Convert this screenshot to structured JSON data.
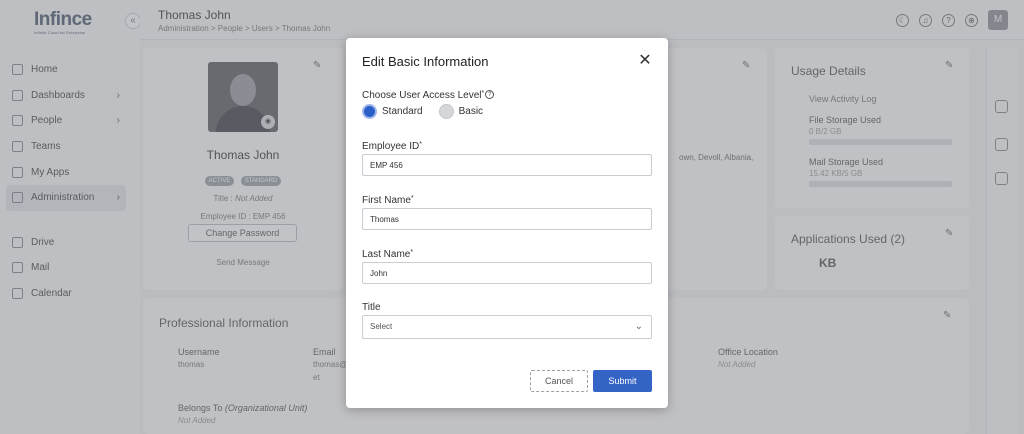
{
  "app": {
    "logo_text": "Infince",
    "logo_tagline": "Infinite Cloud for Enterprise",
    "collapse_glyph": "«"
  },
  "sidebar": {
    "items": [
      {
        "label": "Home",
        "icon": "home-icon",
        "has_children": false,
        "active": false
      },
      {
        "label": "Dashboards",
        "icon": "dashboard-icon",
        "has_children": true,
        "active": false
      },
      {
        "label": "People",
        "icon": "people-icon",
        "has_children": true,
        "active": false
      },
      {
        "label": "Teams",
        "icon": "teams-icon",
        "has_children": false,
        "active": false
      },
      {
        "label": "My Apps",
        "icon": "apps-icon",
        "has_children": false,
        "active": false
      },
      {
        "label": "Administration",
        "icon": "admin-icon",
        "has_children": true,
        "active": true
      }
    ],
    "secondary_items": [
      {
        "label": "Drive",
        "icon": "drive-icon"
      },
      {
        "label": "Mail",
        "icon": "mail-icon"
      },
      {
        "label": "Calendar",
        "icon": "calendar-icon"
      }
    ]
  },
  "header": {
    "title": "Thomas John",
    "breadcrumb": "Administration > People > Users > Thomas John",
    "avatar_initial": "M",
    "icons": [
      "moon-icon",
      "bell-icon",
      "help-icon",
      "globe-icon"
    ]
  },
  "profile": {
    "name": "Thomas John",
    "badges": [
      "ACTIVE",
      "STANDARD"
    ],
    "title_label": "Title :",
    "title_value": "Not Added",
    "employee_id_line": "Employee ID : EMP 456",
    "change_password": "Change Password",
    "send_message": "Send Message"
  },
  "address_snippet": "own, Devoll, Albania,",
  "usage": {
    "title": "Usage Details",
    "activity_log": "View Activity Log",
    "file_label": "File Storage Used",
    "file_value": "0 B/2 GB",
    "mail_label": "Mail Storage Used",
    "mail_value": "15.42 KB/5 GB"
  },
  "apps_used": {
    "title": "Applications Used (2)",
    "app_label": "KB"
  },
  "professional": {
    "title": "Professional Information",
    "username_label": "Username",
    "username_value": "thomas",
    "email_label": "Email",
    "email_value": "thomas@",
    "email_value_2": "et",
    "office_label": "Office Location",
    "office_value": "Not Added",
    "belongs_label": "Belongs To",
    "belongs_suffix": "(Organizational Unit)",
    "belongs_value": "Not Added"
  },
  "modal": {
    "title": "Edit Basic Information",
    "close_glyph": "✕",
    "access_label": "Choose User Access Level",
    "access_options": [
      {
        "label": "Standard",
        "selected": true
      },
      {
        "label": "Basic",
        "selected": false
      }
    ],
    "employee_id_label": "Employee ID",
    "employee_id_value": "EMP 456",
    "first_name_label": "First Name",
    "first_name_value": "Thomas",
    "last_name_label": "Last Name",
    "last_name_value": "John",
    "title_label": "Title",
    "title_value": "Select",
    "required_mark": "*",
    "cancel_label": "Cancel",
    "submit_label": "Submit"
  },
  "colors": {
    "primary": "#3564c7",
    "radio_selected": "#2a5fca"
  }
}
